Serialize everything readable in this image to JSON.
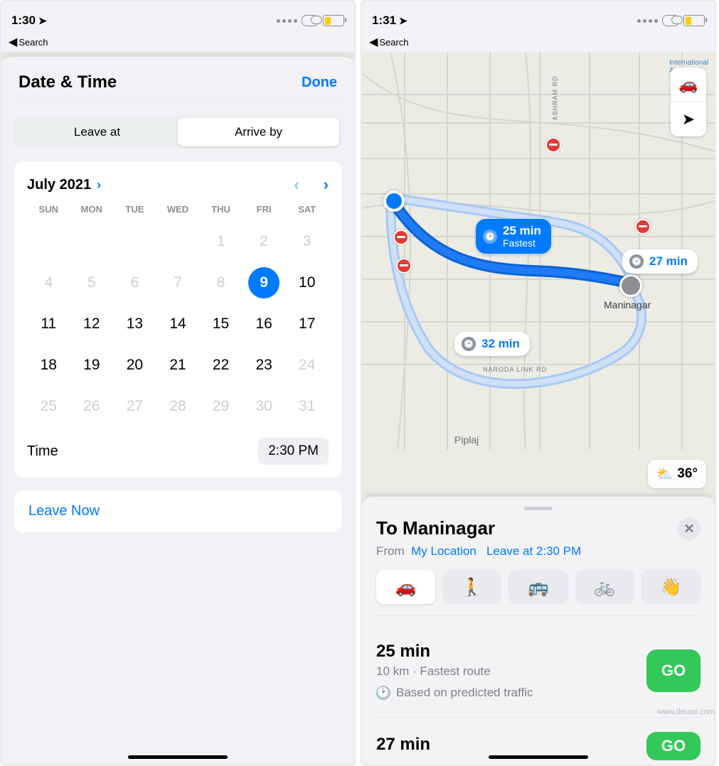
{
  "left": {
    "status": {
      "time": "1:30",
      "back_label": "Search"
    },
    "sheet": {
      "title": "Date & Time",
      "done": "Done",
      "segments": {
        "leave": "Leave at",
        "arrive": "Arrive by"
      },
      "calendar": {
        "month": "July 2021",
        "dow": [
          "SUN",
          "MON",
          "TUE",
          "WED",
          "THU",
          "FRI",
          "SAT"
        ],
        "rows": [
          [
            {
              "d": ""
            },
            {
              "d": ""
            },
            {
              "d": ""
            },
            {
              "d": ""
            },
            {
              "d": "1",
              "dim": true
            },
            {
              "d": "2",
              "dim": true
            },
            {
              "d": "3",
              "dim": true
            }
          ],
          [
            {
              "d": "4",
              "dim": true
            },
            {
              "d": "5",
              "dim": true
            },
            {
              "d": "6",
              "dim": true
            },
            {
              "d": "7",
              "dim": true
            },
            {
              "d": "8",
              "dim": true
            },
            {
              "d": "9",
              "sel": true
            },
            {
              "d": "10"
            }
          ],
          [
            {
              "d": "11"
            },
            {
              "d": "12"
            },
            {
              "d": "13"
            },
            {
              "d": "14"
            },
            {
              "d": "15"
            },
            {
              "d": "16"
            },
            {
              "d": "17"
            }
          ],
          [
            {
              "d": "18"
            },
            {
              "d": "19"
            },
            {
              "d": "20"
            },
            {
              "d": "21"
            },
            {
              "d": "22"
            },
            {
              "d": "23"
            },
            {
              "d": "24",
              "dim": true
            }
          ],
          [
            {
              "d": "25",
              "dim": true
            },
            {
              "d": "26",
              "dim": true
            },
            {
              "d": "27",
              "dim": true
            },
            {
              "d": "28",
              "dim": true
            },
            {
              "d": "29",
              "dim": true
            },
            {
              "d": "30",
              "dim": true
            },
            {
              "d": "31",
              "dim": true
            }
          ]
        ]
      },
      "time_label": "Time",
      "time_value": "2:30 PM",
      "leave_now": "Leave Now"
    }
  },
  "right": {
    "status": {
      "time": "1:31",
      "back_label": "Search"
    },
    "map": {
      "callouts": {
        "fastest": {
          "time": "25 min",
          "sub": "Fastest"
        },
        "alt1": "27 min",
        "alt2": "32 min"
      },
      "roads": {
        "naroda": "NARODA LINK RD",
        "ashram": "ASHRAM RD"
      },
      "dest_label": "Maninagar",
      "area_label": "Piplaj",
      "weather": "36°",
      "airport_label": "International Airport MD"
    },
    "directions": {
      "title": "To Maninagar",
      "from_label": "From",
      "from_value": "My Location",
      "leave_value": "Leave at 2:30 PM",
      "routes": [
        {
          "time": "25 min",
          "detail": "10 km · Fastest route",
          "traffic": "Based on predicted traffic",
          "go": "GO"
        },
        {
          "time": "27 min",
          "detail": "",
          "traffic": "",
          "go": "GO"
        }
      ]
    }
  },
  "watermark": "www.deuao.com"
}
